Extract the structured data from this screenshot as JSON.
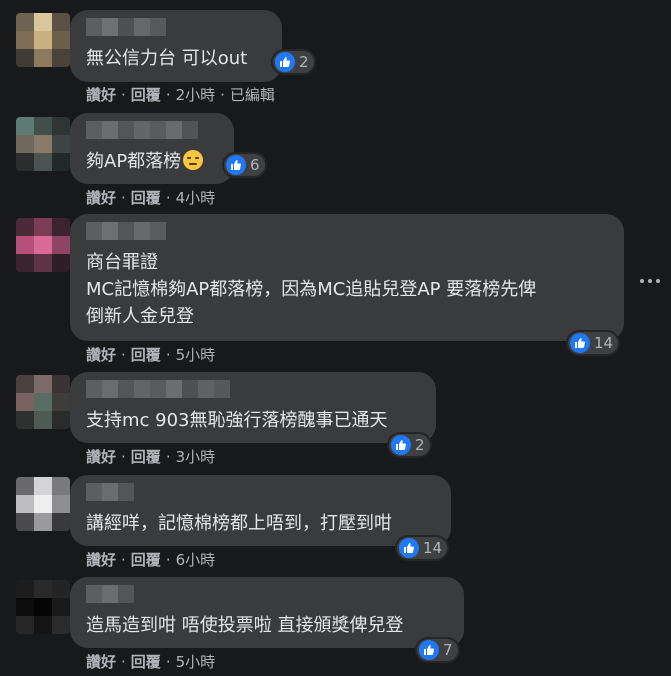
{
  "actions": {
    "like_label": "讚好",
    "reply_label": "回覆",
    "separator": "·"
  },
  "comments": [
    {
      "text": "無公信力台 可以out",
      "like_count": "2",
      "time": "2小時",
      "edited_label": "已編輯"
    },
    {
      "text": "夠AP都落榜",
      "emoji": "relieved-face",
      "like_count": "6",
      "time": "4小時"
    },
    {
      "text": "商台罪證\nMC記憶棉夠AP都落榜，因為MC追貼兒登AP 要落榜先俾\n倒新人金兒登",
      "like_count": "14",
      "time": "5小時"
    },
    {
      "text": "支持mc 903無恥強行落榜醜事已通天",
      "like_count": "2",
      "time": "3小時"
    },
    {
      "text": "講經咩，記憶棉榜都上唔到，打壓到咁",
      "like_count": "14",
      "time": "6小時"
    },
    {
      "text": "造馬造到咁 唔使投票啦 直接頒獎俾兒登",
      "like_count": "7",
      "time": "5小時"
    }
  ],
  "icons": {
    "reaction": "like-icon",
    "more": "more-options-icon"
  },
  "colors": {
    "background": "#18191a",
    "bubble": "#3a3b3c",
    "text": "#e4e6eb",
    "secondary_text": "#b0b3b8",
    "like_blue": "#2078f4"
  }
}
